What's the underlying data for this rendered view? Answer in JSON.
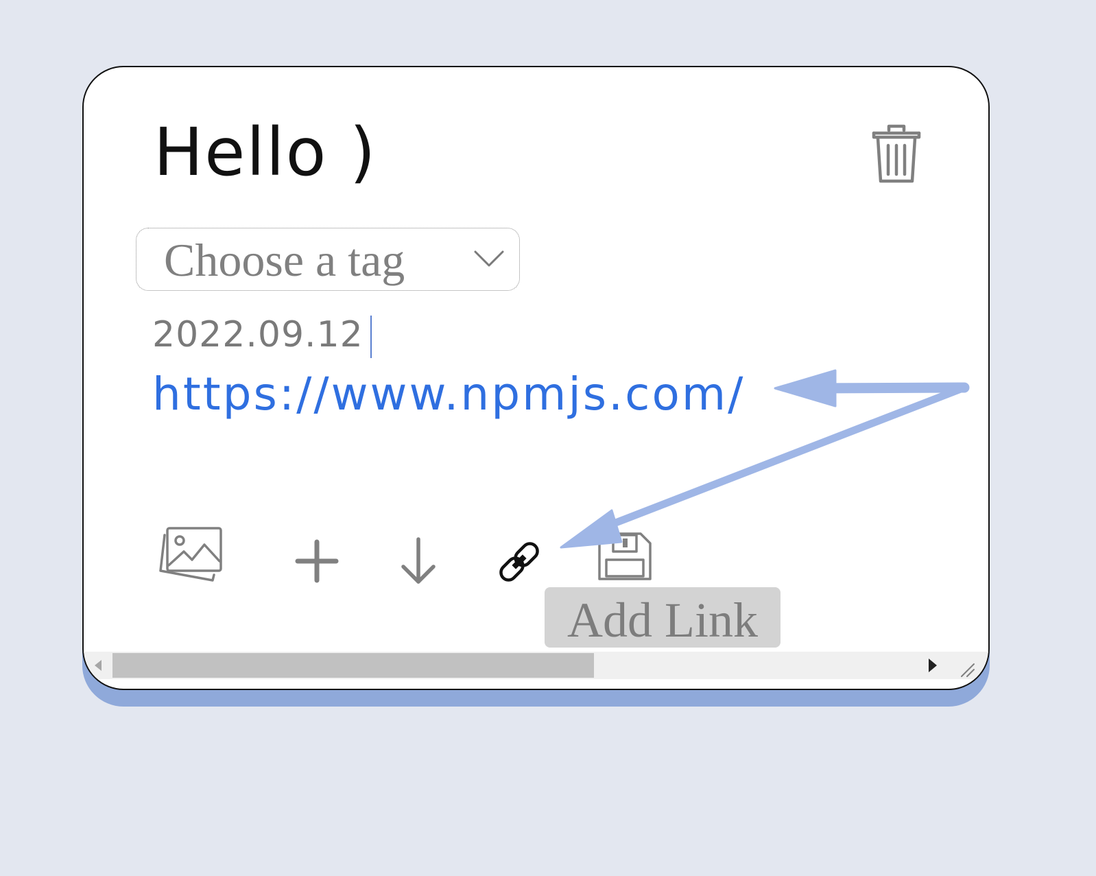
{
  "note": {
    "title": "Hello )",
    "tag_select": {
      "placeholder": "Choose a tag"
    },
    "date": "2022.09.12",
    "link": "https://www.npmjs.com/"
  },
  "toolbar": {
    "image_icon": "images-icon",
    "add_icon": "plus-icon",
    "download_icon": "arrow-down-icon",
    "link_icon": "link-icon",
    "save_icon": "floppy-disk-icon",
    "tooltip": "Add Link"
  },
  "icons": {
    "delete": "trash-icon"
  },
  "colors": {
    "background": "#e3e7f0",
    "card": "#ffffff",
    "card_shadow": "#8fa9da",
    "link": "#2f6fe0",
    "annotation_arrow": "#9fb6e6"
  }
}
